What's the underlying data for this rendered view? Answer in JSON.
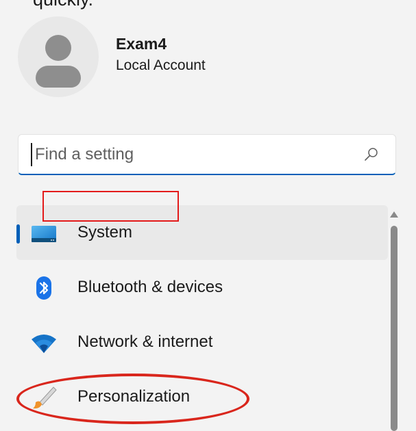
{
  "header": {
    "partial_text": "quickly."
  },
  "profile": {
    "name": "Exam4",
    "account_type": "Local Account"
  },
  "search": {
    "placeholder": "Find a setting",
    "value": ""
  },
  "nav": {
    "items": [
      {
        "label": "System",
        "icon": "system-display-icon",
        "selected": true
      },
      {
        "label": "Bluetooth & devices",
        "icon": "bluetooth-icon",
        "selected": false
      },
      {
        "label": "Network & internet",
        "icon": "wifi-icon",
        "selected": false
      },
      {
        "label": "Personalization",
        "icon": "paintbrush-icon",
        "selected": false
      }
    ]
  },
  "colors": {
    "accent": "#005fb8",
    "background": "#f3f3f3",
    "annotation_red": "#e31a1a"
  }
}
